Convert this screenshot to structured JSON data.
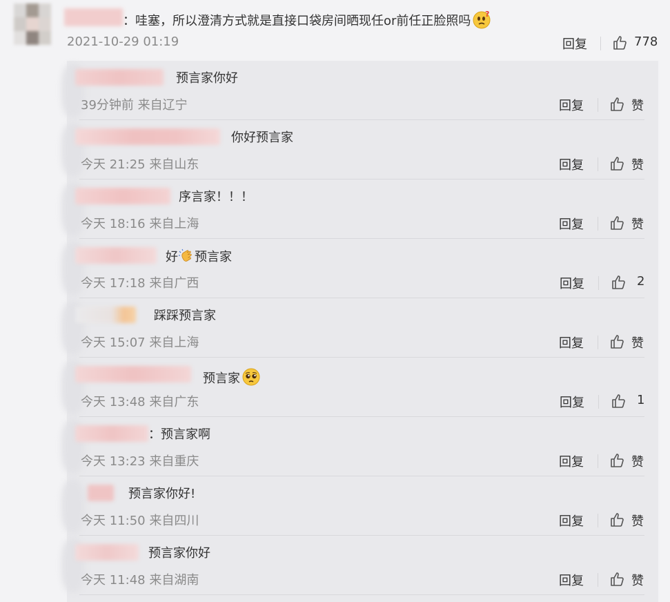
{
  "main": {
    "text": "：哇塞，所以澄清方式就是直接口袋房间晒现任or前任正脸照吗",
    "emoji": "thinking-question-face",
    "time": "2021-10-29 01:19",
    "reply_label": "回复",
    "like_count": "778"
  },
  "replies": [
    {
      "text": "预言家你好",
      "meta": "39分钟前 来自辽宁",
      "reply_label": "回复",
      "like": "赞"
    },
    {
      "text": "你好预言家",
      "meta": "今天 21:25 来自山东",
      "reply_label": "回复",
      "like": "赞"
    },
    {
      "text": "序言家！！！",
      "meta": "今天 18:16 来自上海",
      "reply_label": "回复",
      "like": "赞"
    },
    {
      "text_a": "好",
      "emoji": "clapping-hands",
      "text_b": "预言家",
      "meta": "今天 17:18 来自广西",
      "reply_label": "回复",
      "like": "2"
    },
    {
      "text": "踩踩预言家",
      "meta": "今天 15:07 来自上海",
      "reply_label": "回复",
      "like": "赞"
    },
    {
      "text": "预言家",
      "emoji": "pleading-face",
      "meta": "今天 13:48 来自广东",
      "reply_label": "回复",
      "like": "1"
    },
    {
      "text": "：预言家啊",
      "meta": "今天 13:23 来自重庆",
      "reply_label": "回复",
      "like": "赞"
    },
    {
      "text": "预言家你好!",
      "meta": "今天 11:50 来自四川",
      "reply_label": "回复",
      "like": "赞"
    },
    {
      "text": "预言家你好",
      "meta": "今天 11:48 来自湖南",
      "reply_label": "回复",
      "like": "赞"
    }
  ],
  "colors": {
    "background": "#f3f3f5",
    "reply_background": "#e9e9ec",
    "text": "#333333",
    "meta": "#8a8a8a",
    "name_redaction": "#f2c9c9"
  }
}
